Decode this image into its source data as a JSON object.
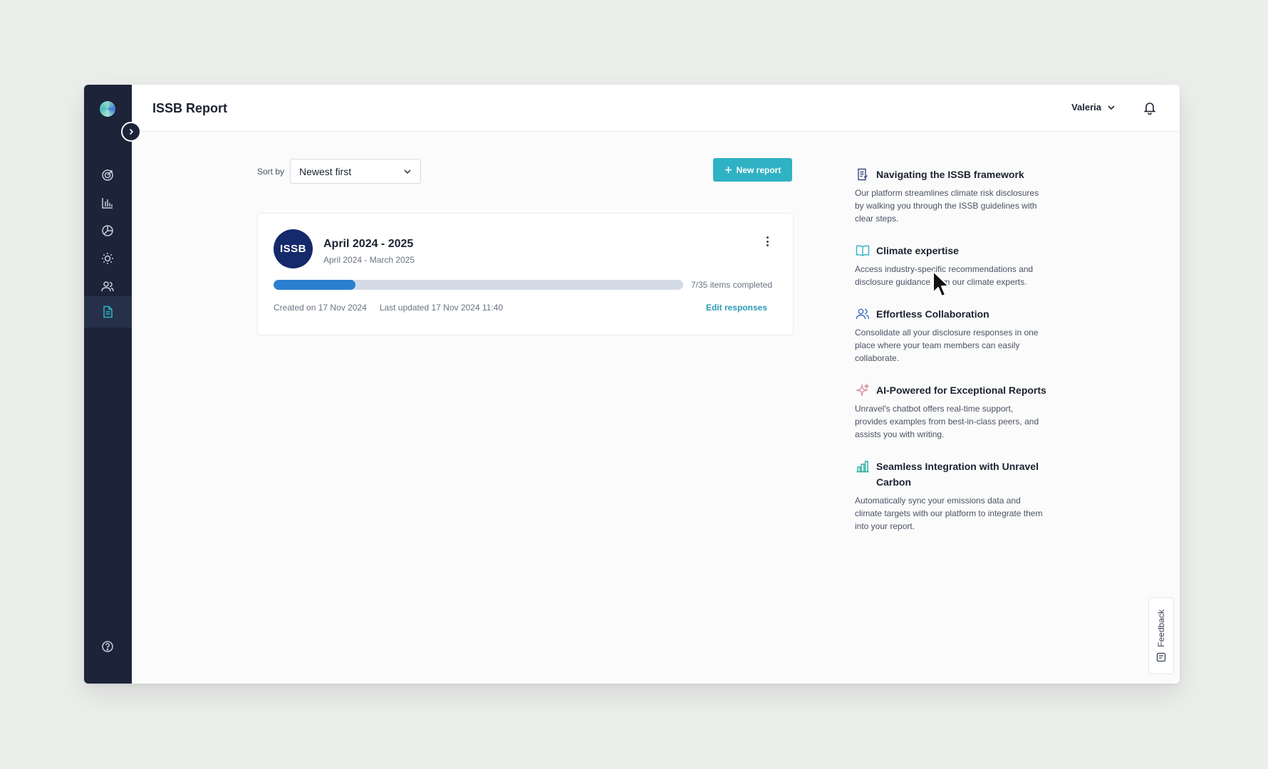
{
  "app": {
    "page_title": "ISSB Report",
    "user_name": "Valeria"
  },
  "toolbar": {
    "sort_label": "Sort by",
    "sort_value": "Newest first",
    "new_report_label": "New report"
  },
  "report": {
    "badge": "ISSB",
    "title": "April 2024 - 2025",
    "subtitle": "April 2024 - March 2025",
    "progress_fraction": 0.2,
    "progress_text": "7/35 items completed",
    "created": "Created on 17 Nov 2024",
    "updated": "Last updated 17 Nov 2024 11:40",
    "edit_label": "Edit responses"
  },
  "info": {
    "items": [
      {
        "icon": "checklist-doc-icon",
        "title": "Navigating the ISSB framework",
        "desc": "Our platform streamlines climate risk disclosures by walking you through the ISSB guidelines with clear steps."
      },
      {
        "icon": "book-icon",
        "title": "Climate expertise",
        "desc": "Access industry-specific recommendations and disclosure guidance from our climate experts."
      },
      {
        "icon": "users-icon",
        "title": "Effortless Collaboration",
        "desc": "Consolidate all your disclosure responses in one place where your team members can easily collaborate."
      },
      {
        "icon": "sparkle-icon",
        "title": "AI-Powered for Exceptional Reports",
        "desc": "Unravel's chatbot offers real-time support, provides examples from best-in-class peers, and assists you with writing."
      },
      {
        "icon": "bar-chart-icon",
        "title": "Seamless Integration with Unravel Carbon",
        "desc": "Automatically sync your emissions data and climate targets with our platform to integrate them into your report."
      }
    ]
  },
  "feedback": {
    "label": "Feedback"
  },
  "colors": {
    "sidebar": "#1d2339",
    "accent": "#2fb2c4",
    "progress": "#2a7fcf",
    "badge": "#152a6b"
  }
}
